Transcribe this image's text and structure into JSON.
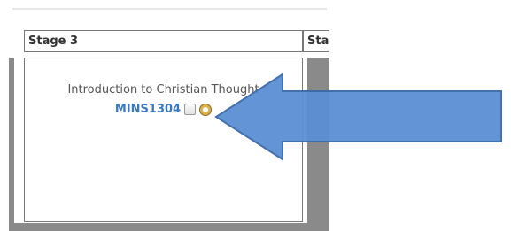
{
  "table": {
    "headers": [
      "Stage 3",
      "Sta"
    ],
    "course": {
      "title": "Introduction to Christian Thought",
      "code": "MINS1304"
    }
  },
  "annotation": {
    "icon": "arrow-left",
    "fill": "#5b8fd4",
    "stroke": "#3b6aa8"
  }
}
